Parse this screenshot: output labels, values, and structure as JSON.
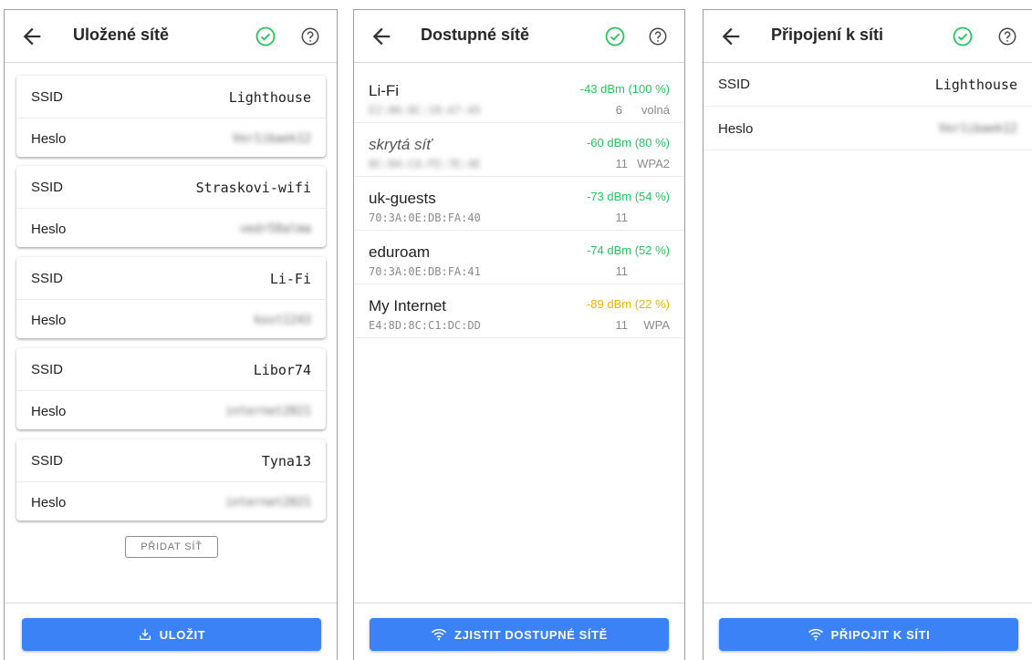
{
  "colors": {
    "accent": "#3b82f6",
    "ok": "#22c55e",
    "signal_good": "#22c55e",
    "signal_weak": "#eab308"
  },
  "labels": {
    "ssid": "SSID",
    "password": "Heslo"
  },
  "saved": {
    "title": "Uložené sítě",
    "networks": [
      {
        "ssid": "Lighthouse",
        "password": "Ver1ibaek12"
      },
      {
        "ssid": "Straskovi-wifi",
        "password": "vedr58alma"
      },
      {
        "ssid": "Li-Fi",
        "password": "kost1243"
      },
      {
        "ssid": "Libor74",
        "password": "internet2021"
      },
      {
        "ssid": "Tyna13",
        "password": "internet2021"
      }
    ],
    "add_label": "PŘIDAT SÍŤ",
    "save_label": "ULOŽIT",
    "save_icon": "download-icon"
  },
  "available": {
    "title": "Dostupné sítě",
    "networks": [
      {
        "name": "Li-Fi",
        "signal": "-43 dBm (100 %)",
        "mac": "E2:06:8C:18:A7:45",
        "channel": "6",
        "security": "volná"
      },
      {
        "name": "skrytá síť",
        "signal": "-60 dBm (80 %)",
        "mac": "8C:84:CA:FE:7E:4E",
        "channel": "11",
        "security": "WPA2"
      },
      {
        "name": "uk-guests",
        "signal": "-73 dBm (54 %)",
        "mac": "70:3A:0E:DB:FA:40",
        "channel": "11",
        "security": ""
      },
      {
        "name": "eduroam",
        "signal": "-74 dBm (52 %)",
        "mac": "70:3A:0E:DB:FA:41",
        "channel": "11",
        "security": ""
      },
      {
        "name": "My Internet",
        "signal": "-89 dBm (22 %)",
        "mac": "E4:8D:8C:C1:DC:DD",
        "channel": "11",
        "security": "WPA"
      }
    ],
    "scan_label": "ZJISTIT DOSTUPNÉ SÍTĚ",
    "scan_icon": "wifi-icon"
  },
  "connect": {
    "title": "Připojení k síti",
    "ssid": "Lighthouse",
    "password": "Ver1ibaek12",
    "connect_label": "PŘIPOJIT K SÍTI",
    "connect_icon": "wifi-icon"
  }
}
